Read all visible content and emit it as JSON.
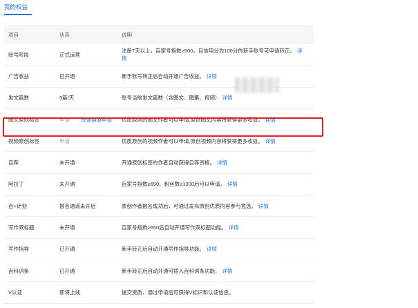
{
  "tab": {
    "label": "我的权益"
  },
  "table": {
    "headers": [
      "项目",
      "状态",
      "说明"
    ],
    "rows": [
      {
        "item": "账号阶段",
        "status": "正式运营",
        "desc": "注册7天以上，百家号指数≥500，且信用分为100分的新手账号可申请转正。",
        "link": "详情"
      },
      {
        "item": "广告收益",
        "status": "已开通",
        "desc": "新手账号转正后自动开通广告收益。",
        "link": "详情"
      },
      {
        "item": "发文篇数",
        "status": "5篇/天",
        "desc": "账号当前发文篇数（含图文、图集、视频）",
        "link": "详情"
      },
      {
        "item": "图文原创标签",
        "status": "申请",
        "quick": "快速通道申请",
        "desc": "优质原创的图文作者可以申请,原创图文内容将获得更多收益。",
        "link": "详情"
      },
      {
        "item": "视频原创标签",
        "status": "申请",
        "desc": "优质原创的视频作者可以申请,原创视频内容将获得更多收益。",
        "link": "详情"
      },
      {
        "item": "自荐",
        "status": "未开通",
        "desc": "开通原创标签的作者自动获得自荐资格。",
        "link": "详情"
      },
      {
        "item": "阿拉丁",
        "status": "未开通",
        "desc": "百家号指数≥650、粉丝数≥1000后可以申请。",
        "link": "详情"
      },
      {
        "item": "百+计划",
        "status": "报名通道未开启",
        "desc": "原创作者报名成功后，可通过发布原创优质内容参与竞选。",
        "link": "详情"
      },
      {
        "item": "写作双标题",
        "status": "未开通",
        "desc": "百家号指数≥650后自动开通写作双标题功能。",
        "link": "详情"
      },
      {
        "item": "写作指导",
        "status": "已开通",
        "desc": "新手转正后自动开通写作指导功能。",
        "link": "详情"
      },
      {
        "item": "百科词条",
        "status": "已开通",
        "desc": "新手转正后自动开通可插入百科词条功能。",
        "link": "详情"
      },
      {
        "item": "V认证",
        "status": "即将上线",
        "desc": "提交资质，通过申请后可获得V标识和认证信息。",
        "link": ""
      }
    ]
  }
}
